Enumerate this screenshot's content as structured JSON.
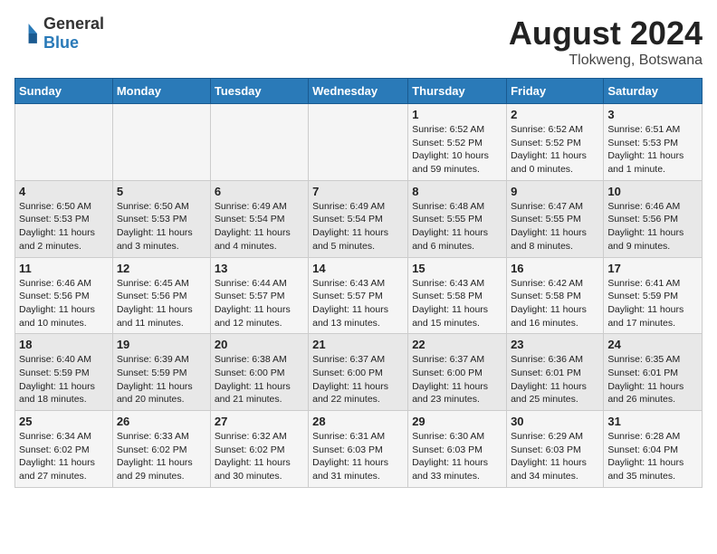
{
  "header": {
    "logo_line1": "General",
    "logo_line2": "Blue",
    "month_year": "August 2024",
    "location": "Tlokweng, Botswana"
  },
  "weekdays": [
    "Sunday",
    "Monday",
    "Tuesday",
    "Wednesday",
    "Thursday",
    "Friday",
    "Saturday"
  ],
  "weeks": [
    [
      {
        "day": "",
        "sunrise": "",
        "sunset": "",
        "daylight": ""
      },
      {
        "day": "",
        "sunrise": "",
        "sunset": "",
        "daylight": ""
      },
      {
        "day": "",
        "sunrise": "",
        "sunset": "",
        "daylight": ""
      },
      {
        "day": "",
        "sunrise": "",
        "sunset": "",
        "daylight": ""
      },
      {
        "day": "1",
        "sunrise": "Sunrise: 6:52 AM",
        "sunset": "Sunset: 5:52 PM",
        "daylight": "Daylight: 10 hours and 59 minutes."
      },
      {
        "day": "2",
        "sunrise": "Sunrise: 6:52 AM",
        "sunset": "Sunset: 5:52 PM",
        "daylight": "Daylight: 11 hours and 0 minutes."
      },
      {
        "day": "3",
        "sunrise": "Sunrise: 6:51 AM",
        "sunset": "Sunset: 5:53 PM",
        "daylight": "Daylight: 11 hours and 1 minute."
      }
    ],
    [
      {
        "day": "4",
        "sunrise": "Sunrise: 6:50 AM",
        "sunset": "Sunset: 5:53 PM",
        "daylight": "Daylight: 11 hours and 2 minutes."
      },
      {
        "day": "5",
        "sunrise": "Sunrise: 6:50 AM",
        "sunset": "Sunset: 5:53 PM",
        "daylight": "Daylight: 11 hours and 3 minutes."
      },
      {
        "day": "6",
        "sunrise": "Sunrise: 6:49 AM",
        "sunset": "Sunset: 5:54 PM",
        "daylight": "Daylight: 11 hours and 4 minutes."
      },
      {
        "day": "7",
        "sunrise": "Sunrise: 6:49 AM",
        "sunset": "Sunset: 5:54 PM",
        "daylight": "Daylight: 11 hours and 5 minutes."
      },
      {
        "day": "8",
        "sunrise": "Sunrise: 6:48 AM",
        "sunset": "Sunset: 5:55 PM",
        "daylight": "Daylight: 11 hours and 6 minutes."
      },
      {
        "day": "9",
        "sunrise": "Sunrise: 6:47 AM",
        "sunset": "Sunset: 5:55 PM",
        "daylight": "Daylight: 11 hours and 8 minutes."
      },
      {
        "day": "10",
        "sunrise": "Sunrise: 6:46 AM",
        "sunset": "Sunset: 5:56 PM",
        "daylight": "Daylight: 11 hours and 9 minutes."
      }
    ],
    [
      {
        "day": "11",
        "sunrise": "Sunrise: 6:46 AM",
        "sunset": "Sunset: 5:56 PM",
        "daylight": "Daylight: 11 hours and 10 minutes."
      },
      {
        "day": "12",
        "sunrise": "Sunrise: 6:45 AM",
        "sunset": "Sunset: 5:56 PM",
        "daylight": "Daylight: 11 hours and 11 minutes."
      },
      {
        "day": "13",
        "sunrise": "Sunrise: 6:44 AM",
        "sunset": "Sunset: 5:57 PM",
        "daylight": "Daylight: 11 hours and 12 minutes."
      },
      {
        "day": "14",
        "sunrise": "Sunrise: 6:43 AM",
        "sunset": "Sunset: 5:57 PM",
        "daylight": "Daylight: 11 hours and 13 minutes."
      },
      {
        "day": "15",
        "sunrise": "Sunrise: 6:43 AM",
        "sunset": "Sunset: 5:58 PM",
        "daylight": "Daylight: 11 hours and 15 minutes."
      },
      {
        "day": "16",
        "sunrise": "Sunrise: 6:42 AM",
        "sunset": "Sunset: 5:58 PM",
        "daylight": "Daylight: 11 hours and 16 minutes."
      },
      {
        "day": "17",
        "sunrise": "Sunrise: 6:41 AM",
        "sunset": "Sunset: 5:59 PM",
        "daylight": "Daylight: 11 hours and 17 minutes."
      }
    ],
    [
      {
        "day": "18",
        "sunrise": "Sunrise: 6:40 AM",
        "sunset": "Sunset: 5:59 PM",
        "daylight": "Daylight: 11 hours and 18 minutes."
      },
      {
        "day": "19",
        "sunrise": "Sunrise: 6:39 AM",
        "sunset": "Sunset: 5:59 PM",
        "daylight": "Daylight: 11 hours and 20 minutes."
      },
      {
        "day": "20",
        "sunrise": "Sunrise: 6:38 AM",
        "sunset": "Sunset: 6:00 PM",
        "daylight": "Daylight: 11 hours and 21 minutes."
      },
      {
        "day": "21",
        "sunrise": "Sunrise: 6:37 AM",
        "sunset": "Sunset: 6:00 PM",
        "daylight": "Daylight: 11 hours and 22 minutes."
      },
      {
        "day": "22",
        "sunrise": "Sunrise: 6:37 AM",
        "sunset": "Sunset: 6:00 PM",
        "daylight": "Daylight: 11 hours and 23 minutes."
      },
      {
        "day": "23",
        "sunrise": "Sunrise: 6:36 AM",
        "sunset": "Sunset: 6:01 PM",
        "daylight": "Daylight: 11 hours and 25 minutes."
      },
      {
        "day": "24",
        "sunrise": "Sunrise: 6:35 AM",
        "sunset": "Sunset: 6:01 PM",
        "daylight": "Daylight: 11 hours and 26 minutes."
      }
    ],
    [
      {
        "day": "25",
        "sunrise": "Sunrise: 6:34 AM",
        "sunset": "Sunset: 6:02 PM",
        "daylight": "Daylight: 11 hours and 27 minutes."
      },
      {
        "day": "26",
        "sunrise": "Sunrise: 6:33 AM",
        "sunset": "Sunset: 6:02 PM",
        "daylight": "Daylight: 11 hours and 29 minutes."
      },
      {
        "day": "27",
        "sunrise": "Sunrise: 6:32 AM",
        "sunset": "Sunset: 6:02 PM",
        "daylight": "Daylight: 11 hours and 30 minutes."
      },
      {
        "day": "28",
        "sunrise": "Sunrise: 6:31 AM",
        "sunset": "Sunset: 6:03 PM",
        "daylight": "Daylight: 11 hours and 31 minutes."
      },
      {
        "day": "29",
        "sunrise": "Sunrise: 6:30 AM",
        "sunset": "Sunset: 6:03 PM",
        "daylight": "Daylight: 11 hours and 33 minutes."
      },
      {
        "day": "30",
        "sunrise": "Sunrise: 6:29 AM",
        "sunset": "Sunset: 6:03 PM",
        "daylight": "Daylight: 11 hours and 34 minutes."
      },
      {
        "day": "31",
        "sunrise": "Sunrise: 6:28 AM",
        "sunset": "Sunset: 6:04 PM",
        "daylight": "Daylight: 11 hours and 35 minutes."
      }
    ]
  ]
}
